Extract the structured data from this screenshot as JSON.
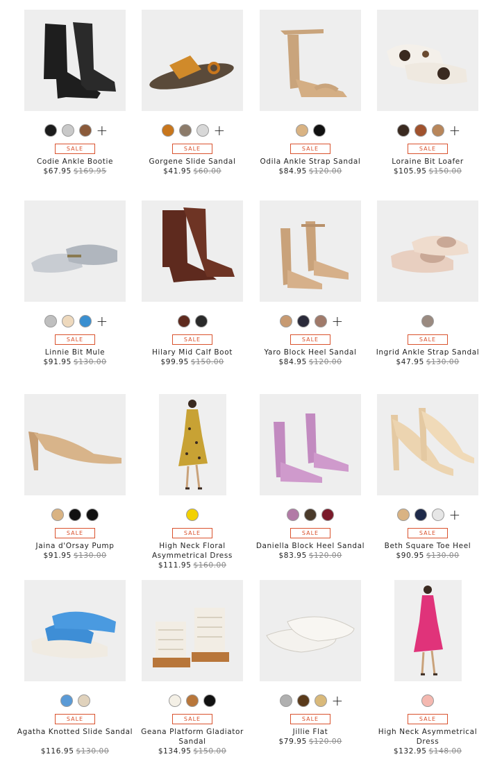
{
  "products": [
    {
      "name": "Codie Ankle Bootie",
      "price": "$67.95",
      "original_price": "$169.95",
      "badge": "SALE",
      "swatches": [
        "#1c1c1c",
        "#c9c9c9",
        "#8a5a3a"
      ],
      "more_colors": "+",
      "image": "black-snakeskin-ankle-bootie"
    },
    {
      "name": "Gorgene Slide Sandal",
      "price": "$41.95",
      "original_price": "$60.00",
      "badge": "SALE",
      "swatches": [
        "#c8761c",
        "#8c7b6a",
        "#d8d8d8"
      ],
      "more_colors": "+",
      "image": "tan-toe-ring-slide-sandal"
    },
    {
      "name": "Odila Ankle Strap Sandal",
      "price": "$84.95",
      "original_price": "$120.00",
      "badge": "SALE",
      "swatches": [
        "#d9b383",
        "#111111"
      ],
      "more_colors": "",
      "image": "nude-ankle-strap-block-heel"
    },
    {
      "name": "Loraine Bit Loafer",
      "price": "$105.95",
      "original_price": "$150.00",
      "badge": "SALE",
      "swatches": [
        "#3a2a20",
        "#a0522d",
        "#b8865a"
      ],
      "more_colors": "+",
      "image": "cow-print-bit-loafer"
    },
    {
      "name": "Linnie Bit Mule",
      "price": "$91.95",
      "original_price": "$130.00",
      "badge": "SALE",
      "swatches": [
        "#bfbfbf",
        "#eed9bd",
        "#3a8fd0"
      ],
      "more_colors": "+",
      "image": "silver-metallic-bit-mule"
    },
    {
      "name": "Hilary Mid Calf Boot",
      "price": "$99.95",
      "original_price": "$150.00",
      "badge": "SALE",
      "swatches": [
        "#5e2a1e",
        "#2a2a2a"
      ],
      "more_colors": "",
      "image": "brown-leather-mid-calf-boot"
    },
    {
      "name": "Yaro Block Heel Sandal",
      "price": "$84.95",
      "original_price": "$120.00",
      "badge": "SALE",
      "swatches": [
        "#c79a72",
        "#2a2a3a",
        "#a07a6a"
      ],
      "more_colors": "+",
      "image": "tan-block-heel-sandal"
    },
    {
      "name": "Ingrid Ankle Strap Sandal",
      "price": "$47.95",
      "original_price": "$130.00",
      "badge": "SALE",
      "swatches": [
        "#9a8a80"
      ],
      "more_colors": "",
      "image": "rose-gold-knot-sandal"
    },
    {
      "name": "Jaina d'Orsay Pump",
      "price": "$91.95",
      "original_price": "$130.00",
      "badge": "SALE",
      "swatches": [
        "#d9b383",
        "#111111",
        "#111111"
      ],
      "more_colors": "",
      "image": "nude-dorsay-pump"
    },
    {
      "name": "High Neck Floral Asymmetrical Dress",
      "price": "$111.95",
      "original_price": "$160.00",
      "badge": "SALE",
      "swatches": [
        "#f2d100"
      ],
      "more_colors": "",
      "image": "model-yellow-floral-dress"
    },
    {
      "name": "Daniella Block Heel Sandal",
      "price": "$83.95",
      "original_price": "$120.00",
      "badge": "SALE",
      "swatches": [
        "#b27aa6",
        "#4a3a2a",
        "#7a1a2a"
      ],
      "more_colors": "",
      "image": "lilac-croc-block-heel-sandal"
    },
    {
      "name": "Beth Square Toe Heel",
      "price": "$90.95",
      "original_price": "$130.00",
      "badge": "SALE",
      "swatches": [
        "#d9b383",
        "#1e2a4a",
        "#e6e6e6"
      ],
      "more_colors": "+",
      "image": "cream-croc-square-toe-heel"
    },
    {
      "name": "Agatha Knotted Slide Sandal",
      "price": "$116.95",
      "original_price": "$130.00",
      "badge": "SALE",
      "swatches": [
        "#5a9ad6",
        "#e0d2bc"
      ],
      "more_colors": "",
      "image": "blue-knotted-slide-sandal"
    },
    {
      "name": "Geana Platform Gladiator Sandal",
      "price": "$134.95",
      "original_price": "$150.00",
      "badge": "SALE",
      "swatches": [
        "#f4f0e6",
        "#b8763a",
        "#111111"
      ],
      "more_colors": "",
      "image": "white-platform-gladiator"
    },
    {
      "name": "Jillie Flat",
      "price": "$79.95",
      "original_price": "$120.00",
      "badge": "SALE",
      "swatches": [
        "#b0b0b0",
        "#5a3a1a",
        "#d9b97a"
      ],
      "more_colors": "+",
      "image": "white-ballet-flat"
    },
    {
      "name": "High Neck Asymmetrical Dress",
      "price": "$132.95",
      "original_price": "$148.00",
      "badge": "SALE",
      "swatches": [
        "#f4b8b0"
      ],
      "more_colors": "",
      "image": "model-pink-lace-dress"
    }
  ]
}
